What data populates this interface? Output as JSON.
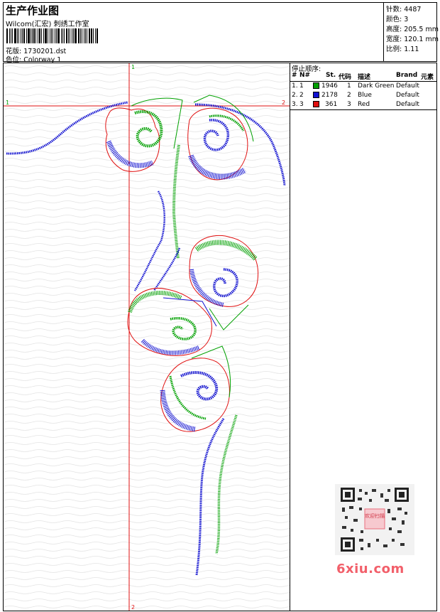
{
  "header": {
    "title": "生产作业图",
    "company": "Wilcom(汇宏) 刺绣工作室",
    "design_label": "花版:",
    "design_value": "1730201.dst",
    "colorway_label": "色位:",
    "colorway_value": "Colorway 1"
  },
  "stats": [
    {
      "label": "针数:",
      "value": "4487"
    },
    {
      "label": "颜色:",
      "value": "3"
    },
    {
      "label": "高度:",
      "value": "205.5 mm"
    },
    {
      "label": "宽度:",
      "value": "120.1 mm"
    },
    {
      "label": "比例:",
      "value": "1.11"
    }
  ],
  "axes": {
    "top_marker": "1",
    "bottom_marker": "2",
    "left_marker": "1",
    "right_marker": "2"
  },
  "stop_sequence": {
    "title": "停止顺序:",
    "headers": {
      "num": "#",
      "no": "N#",
      "st": "St.",
      "code": "代码",
      "desc": "描述",
      "brand": "Brand",
      "element": "元素"
    },
    "rows": [
      {
        "num": "1.",
        "no": "1",
        "color": "#00a000",
        "st": "1946",
        "code": "1",
        "desc": "Dark Green",
        "brand": "Default"
      },
      {
        "num": "2.",
        "no": "2",
        "color": "#1010d0",
        "st": "2178",
        "code": "2",
        "desc": "Blue",
        "brand": "Default"
      },
      {
        "num": "3.",
        "no": "3",
        "color": "#e01010",
        "st": "361",
        "code": "3",
        "desc": "Red",
        "brand": "Default"
      }
    ]
  },
  "watermark": {
    "text": "6xiu.com",
    "qr_badge": "欢迎扫描"
  },
  "colors": {
    "green": "#00a000",
    "blue": "#1010d0",
    "red": "#e01010",
    "watermark": "#f25f6a"
  }
}
